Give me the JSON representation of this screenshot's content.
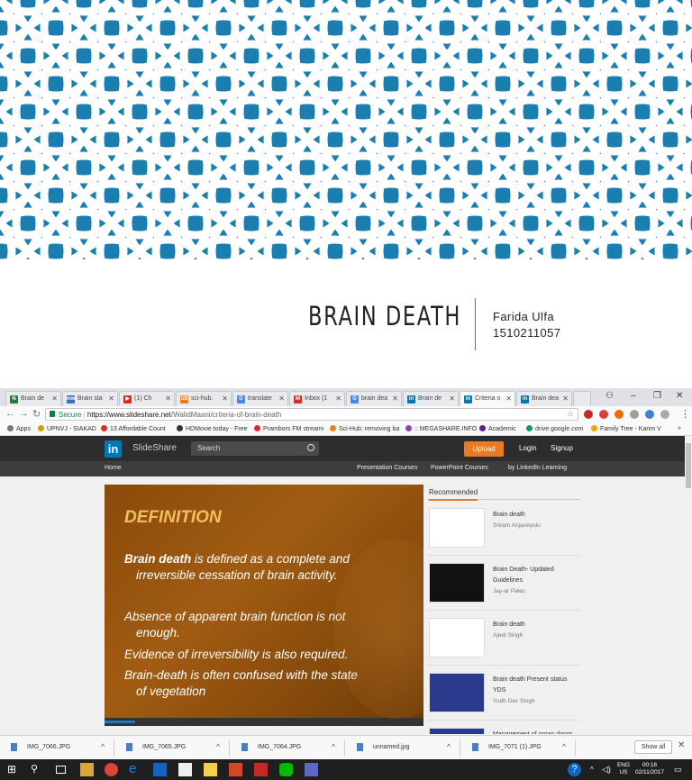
{
  "slide": {
    "title": "BRAIN DEATH",
    "author_name": "Farida Ulfa",
    "author_id": "1510211057"
  },
  "browser": {
    "tabs": [
      {
        "label": "Brain de",
        "color": "#1e7e34",
        "glyph": "N"
      },
      {
        "label": "Brain sta",
        "color": "#3b6fb6",
        "glyph": "ww"
      },
      {
        "label": "(1) Ch",
        "color": "#e62117",
        "glyph": "▶"
      },
      {
        "label": "sci-hub.",
        "color": "#e67e22",
        "glyph": "SB"
      },
      {
        "label": "translate",
        "color": "#4285f4",
        "glyph": "G"
      },
      {
        "label": "Inbox (1",
        "color": "#d93025",
        "glyph": "M"
      },
      {
        "label": "brain dea",
        "color": "#4285f4",
        "glyph": "G"
      },
      {
        "label": "Brain de",
        "color": "#0077b5",
        "glyph": "in"
      },
      {
        "label": "Criteria o",
        "color": "#0077b5",
        "glyph": "in"
      },
      {
        "label": "Brain dea",
        "color": "#0077b5",
        "glyph": "in"
      }
    ],
    "omnibox": {
      "secure_label": "Secure",
      "url_host": "https://www.slideshare.net",
      "url_path": "/WalidMaani/criteria-of-brain-death"
    },
    "bookmarks": [
      {
        "label": "Apps",
        "color": "#777777"
      },
      {
        "label": "UPNVJ - SIAKAD",
        "color": "#c8a200"
      },
      {
        "label": "13 Affordable Count",
        "color": "#d93025"
      },
      {
        "label": "HDMovie.today - Free",
        "color": "#333333"
      },
      {
        "label": "Prambors FM streami",
        "color": "#d93025"
      },
      {
        "label": "Sci-Hub: removing ba",
        "color": "#e67e22"
      },
      {
        "label": ":: MEGASHARE.INFO",
        "color": "#8e44ad"
      },
      {
        "label": "Academic",
        "color": "#6a1b9a"
      },
      {
        "label": "drive.google.com",
        "color": "#0f9d58"
      },
      {
        "label": "Family Tree - Karim V",
        "color": "#f4a300"
      }
    ]
  },
  "slideshare": {
    "logo_letters": "in",
    "logo_text": "SlideShare",
    "search_placeholder": "Search",
    "upload_label": "Upload",
    "login_label": "Login",
    "signup_label": "Signup",
    "home_label": "Home",
    "subnav": [
      "Presentation Courses",
      "PowerPoint Courses",
      "by LinkedIn Learning"
    ],
    "slide_heading": "DEFINITION",
    "slide_lines": [
      {
        "bold": "Brain death",
        "rest": " is defined as a complete and",
        "cont": "irreversible cessation of brain activity."
      },
      {
        "bold": "",
        "rest": "Absence of apparent brain function is not",
        "cont": "enough."
      },
      {
        "bold": "",
        "rest": "Evidence of irreversibility is also required.",
        "cont": ""
      },
      {
        "bold": "",
        "rest": "Brain-death is often confused with the state",
        "cont": "of vegetation"
      }
    ],
    "recommended_label": "Recommended",
    "recommended": [
      {
        "title": "Brain death",
        "author": "Sriram Anjaneyulu",
        "thumb": "#ffffff"
      },
      {
        "title": "Brain Death- Updated Guidelines",
        "author": "Jay-ar Palec",
        "thumb": "#111111"
      },
      {
        "title": "Brain death",
        "author": "Ajeet Singh",
        "thumb": "#ffffff"
      },
      {
        "title": "Brain death Present status YDS",
        "author": "Yudh Dev Singh",
        "thumb": "#2b3a8c"
      },
      {
        "title": "Management of organ donor",
        "author": "",
        "thumb": "#2b3a8c"
      }
    ]
  },
  "downloads": {
    "items": [
      "IMG_7066.JPG",
      "IMG_7065.JPG",
      "IMG_7064.JPG",
      "unnamed.jpg",
      "IMG_7071 (1).JPG"
    ],
    "show_all": "Show all"
  },
  "taskbar": {
    "lang_top": "ENG",
    "lang_bottom": "US",
    "time": "00:16",
    "date": "02/11/2017"
  }
}
